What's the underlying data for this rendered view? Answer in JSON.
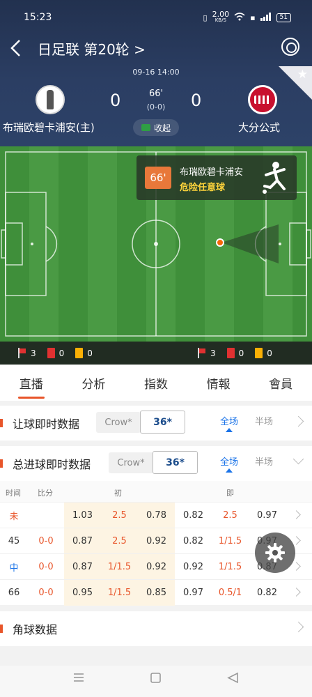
{
  "status_bar": {
    "time": "15:23",
    "speed": "2.00",
    "speed_unit": "KB/S",
    "battery": "51"
  },
  "nav": {
    "title": "日足联 第20轮 >"
  },
  "match": {
    "datetime": "09-16 14:00",
    "home_team": "布瑞欧碧卡浦安(主)",
    "away_team": "大分公式",
    "home_score": "0",
    "away_score": "0",
    "minute": "66'",
    "halftime_score": "(0-0)",
    "collapse_label": "收起"
  },
  "live_event": {
    "minute": "66'",
    "team": "布瑞欧碧卡浦安",
    "type": "危险任意球"
  },
  "field_stats": {
    "home": {
      "corners": "3",
      "red_cards": "0",
      "yellow_cards": "0"
    },
    "away": {
      "corners": "3",
      "red_cards": "0",
      "yellow_cards": "0"
    }
  },
  "tabs": [
    "直播",
    "分析",
    "指数",
    "情報",
    "會員"
  ],
  "active_tab": "直播",
  "handicap_section": {
    "title": "让球即时数据",
    "company": "Crow*",
    "company_id": "36*",
    "option_full": "全场",
    "option_half": "半场"
  },
  "total_goals_section": {
    "title": "总进球即时数据",
    "company": "Crow*",
    "company_id": "36*",
    "option_full": "全场",
    "option_half": "半场"
  },
  "odds_table": {
    "headers": {
      "time": "时间",
      "score": "比分",
      "initial": "初",
      "live": "即"
    },
    "rows": [
      {
        "time": "未",
        "score": "",
        "i1": "1.03",
        "i2": "2.5",
        "i3": "0.78",
        "l1": "0.82",
        "l2": "2.5",
        "l3": "0.97"
      },
      {
        "time": "45",
        "score": "0-0",
        "i1": "0.87",
        "i2": "2.5",
        "i3": "0.92",
        "l1": "0.82",
        "l2": "1/1.5",
        "l3": "0.97"
      },
      {
        "time": "中",
        "score": "0-0",
        "i1": "0.87",
        "i2": "1/1.5",
        "i3": "0.92",
        "l1": "0.92",
        "l2": "1/1.5",
        "l3": "0.87"
      },
      {
        "time": "66",
        "score": "0-0",
        "i1": "0.95",
        "i2": "1/1.5",
        "i3": "0.85",
        "l1": "0.97",
        "l2": "0.5/1",
        "l3": "0.82"
      }
    ]
  },
  "corner_section": {
    "title": "角球数据"
  },
  "colors": {
    "accent": "#e8552a",
    "header_bg": "#2b3e63",
    "field_green": "#4a9a44",
    "highlight": "#fdf4e3"
  }
}
